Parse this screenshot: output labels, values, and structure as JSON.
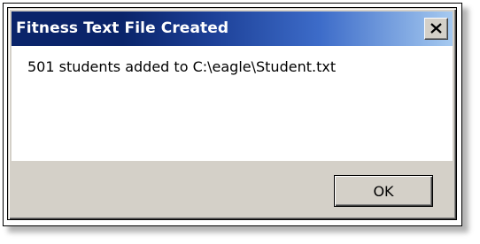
{
  "dialog": {
    "title": "Fitness Text File Created",
    "message": "501 students added to C:\\eagle\\Student.txt",
    "ok_label": "OK",
    "close_icon": "close-icon"
  },
  "colors": {
    "titlebar_start": "#0a246a",
    "titlebar_end": "#a6caf0",
    "dialog_face": "#d4d0c8",
    "content_background": "#ffffff"
  }
}
